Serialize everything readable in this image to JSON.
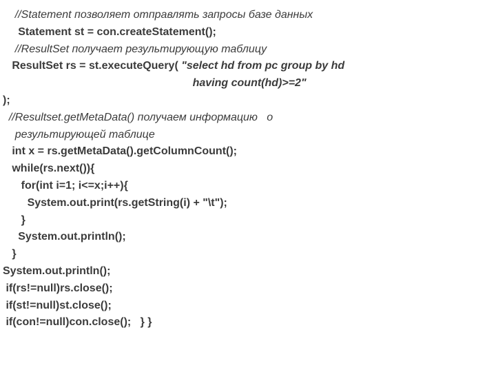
{
  "lines": [
    {
      "indent": "    ",
      "bold": false,
      "italic": true,
      "text": "//Statement позволяет отправлять запросы базе данных"
    },
    {
      "indent": "     ",
      "bold": true,
      "italic": false,
      "text": "Statement st = con.createStatement();"
    },
    {
      "indent": "    ",
      "bold": false,
      "italic": true,
      "text": "//ResultSet получает результирующую таблицу"
    },
    {
      "indent": "   ",
      "bold": true,
      "italic": false,
      "prefix": "ResultSet rs = st.executeQuery( ",
      "query1": "\"select hd from pc group by hd"
    },
    {
      "indent": "                                                              ",
      "bold": true,
      "italic": true,
      "text": "having count(hd)>=2\""
    },
    {
      "indent": "",
      "bold": true,
      "italic": false,
      "text": ");"
    },
    {
      "indent": "  ",
      "bold": false,
      "italic": true,
      "text": "//Resultset.getMetaData() получаем информацию   о"
    },
    {
      "indent": "    ",
      "bold": false,
      "italic": true,
      "text": "результирующей таблице"
    },
    {
      "indent": "   ",
      "bold": true,
      "italic": false,
      "text": "int x = rs.getMetaData().getColumnCount();"
    },
    {
      "indent": "   ",
      "bold": true,
      "italic": false,
      "text": "while(rs.next()){"
    },
    {
      "indent": "      ",
      "bold": true,
      "italic": false,
      "text": "for(int i=1; i<=x;i++){"
    },
    {
      "indent": "        ",
      "bold": true,
      "italic": false,
      "text": "System.out.print(rs.getString(i) + \"\\t\");"
    },
    {
      "indent": "      ",
      "bold": true,
      "italic": false,
      "text": "}"
    },
    {
      "indent": "     ",
      "bold": true,
      "italic": false,
      "text": "System.out.println();"
    },
    {
      "indent": "   ",
      "bold": true,
      "italic": false,
      "text": "}"
    },
    {
      "indent": "",
      "bold": true,
      "italic": false,
      "text": "System.out.println();"
    },
    {
      "indent": " ",
      "bold": true,
      "italic": false,
      "text": "if(rs!=null)rs.close();"
    },
    {
      "indent": " ",
      "bold": true,
      "italic": false,
      "text": "if(st!=null)st.close();"
    },
    {
      "indent": " ",
      "bold": true,
      "italic": false,
      "text": "if(con!=null)con.close();   } }"
    }
  ]
}
